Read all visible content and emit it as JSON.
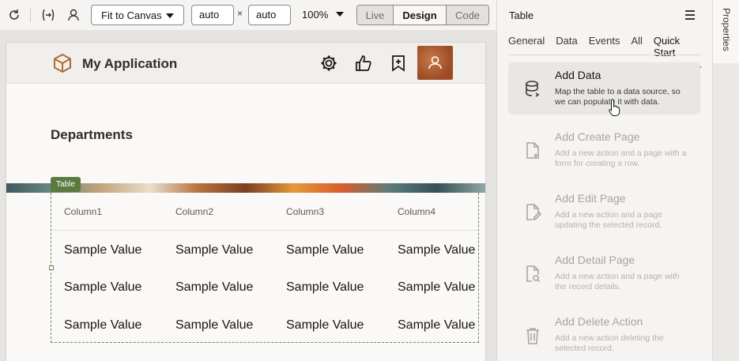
{
  "toolbar": {
    "fit_label": "Fit to Canvas",
    "width_value": "auto",
    "height_value": "auto",
    "times": "×",
    "zoom": "100%",
    "modes": [
      "Live",
      "Design",
      "Code"
    ],
    "active_mode": "Design"
  },
  "app": {
    "title": "My Application",
    "heading": "Departments",
    "table_tag": "Table",
    "columns": [
      "Column1",
      "Column2",
      "Column3",
      "Column4"
    ],
    "rows": [
      [
        "Sample Value",
        "Sample Value",
        "Sample Value",
        "Sample Value"
      ],
      [
        "Sample Value",
        "Sample Value",
        "Sample Value",
        "Sample Value"
      ],
      [
        "Sample Value",
        "Sample Value",
        "Sample Value",
        "Sample Value"
      ]
    ]
  },
  "panel": {
    "title": "Table",
    "tabs": [
      "General",
      "Data",
      "Events",
      "All",
      "Quick Start"
    ],
    "selected_tab": "Quick Start",
    "items": [
      {
        "title": "Add Data",
        "desc": "Map the table to a data source, so we can populate it with data.",
        "icon": "database-icon",
        "enabled": true
      },
      {
        "title": "Add Create Page",
        "desc": "Add a new action and a page with a form for creating a row.",
        "icon": "page-add-icon",
        "enabled": false
      },
      {
        "title": "Add Edit Page",
        "desc": "Add a new action and a page updating the selected record.",
        "icon": "page-edit-icon",
        "enabled": false
      },
      {
        "title": "Add Detail Page",
        "desc": "Add a new action and a page with the record details.",
        "icon": "page-search-icon",
        "enabled": false
      },
      {
        "title": "Add Delete Action",
        "desc": "Add a new action deleting the selected record.",
        "icon": "trash-icon",
        "enabled": false
      }
    ]
  },
  "side": {
    "label": "Properties"
  },
  "colors": {
    "accent": "#5b7a3f",
    "disabled_text": "#a8a5a1"
  }
}
